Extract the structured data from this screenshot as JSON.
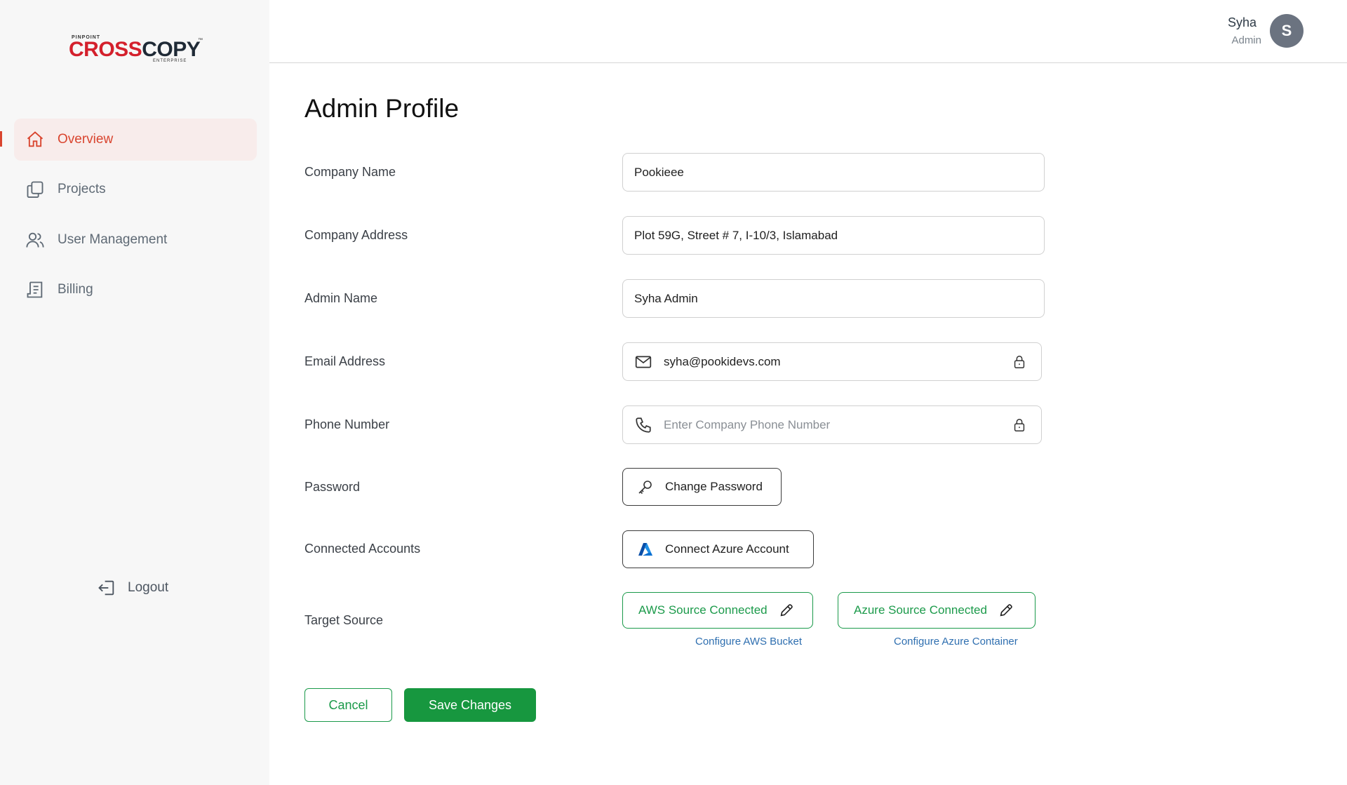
{
  "brand": {
    "top": "PINPOINT",
    "name_red": "CROSS",
    "name_dark": "COPY",
    "tm": "™",
    "bottom": "ENTERPRISE"
  },
  "sidebar": {
    "items": [
      {
        "label": "Overview",
        "icon": "home-icon",
        "active": true
      },
      {
        "label": "Projects",
        "icon": "copy-icon",
        "active": false
      },
      {
        "label": "User Management",
        "icon": "users-icon",
        "active": false
      },
      {
        "label": "Billing",
        "icon": "receipt-icon",
        "active": false
      }
    ],
    "logout_label": "Logout"
  },
  "header": {
    "user_name": "Syha",
    "user_role": "Admin",
    "avatar_initial": "S"
  },
  "page": {
    "title": "Admin Profile"
  },
  "form": {
    "company_name": {
      "label": "Company Name",
      "value": "Pookieee"
    },
    "company_address": {
      "label": "Company Address",
      "value": "Plot 59G, Street # 7, I-10/3, Islamabad"
    },
    "admin_name": {
      "label": "Admin Name",
      "value": "Syha Admin"
    },
    "email": {
      "label": "Email Address",
      "value": "syha@pookidevs.com"
    },
    "phone": {
      "label": "Phone Number",
      "value": "",
      "placeholder": "Enter Company Phone Number"
    },
    "password": {
      "label": "Password",
      "button": "Change Password"
    },
    "connected_accounts": {
      "label": "Connected Accounts",
      "button": "Connect Azure Account"
    },
    "target_source": {
      "label": "Target Source",
      "aws_button": "AWS Source Connected",
      "aws_link": "Configure AWS Bucket",
      "azure_button": "Azure Source Connected",
      "azure_link": "Configure Azure Container"
    }
  },
  "actions": {
    "cancel": "Cancel",
    "save": "Save Changes"
  },
  "colors": {
    "accent_red": "#d9452f",
    "green": "#17973f",
    "link_blue": "#2f6fb0",
    "azure_blue": "#0a6fd1"
  }
}
